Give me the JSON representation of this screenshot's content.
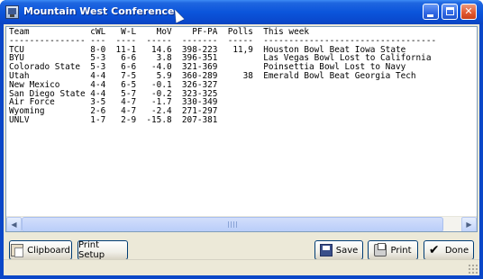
{
  "window": {
    "title": "Mountain West Conference"
  },
  "report": {
    "lines": [
      "Team            cWL   W-L    MoV    PF-PA  Polls  This week",
      "--------------- ---  ----  -----  -------  -----  ----------------------------------",
      "TCU             8-0  11-1   14.6  398-223   11,9  Houston Bowl Beat Iowa State",
      "BYU             5-3   6-6    3.8  396-351         Las Vegas Bowl Lost to California",
      "Colorado State  5-3   6-6   -4.0  321-369         Poinsettia Bowl Lost to Navy",
      "Utah            4-4   7-5    5.9  360-289     38  Emerald Bowl Beat Georgia Tech",
      "New Mexico      4-4   6-5   -0.1  326-327",
      "San Diego State 4-4   5-7   -0.2  323-325",
      "Air Force       3-5   4-7   -1.7  330-349",
      "Wyoming         2-6   4-7   -2.4  271-297",
      "UNLV            1-7   2-9  -15.8  207-381"
    ]
  },
  "buttons": {
    "clipboard": "Clipboard",
    "print_setup": "Print Setup",
    "save": "Save",
    "print": "Print",
    "done": "Done"
  },
  "icons": {
    "scroll_left": "◀",
    "scroll_right": "▶",
    "done_check": "✔"
  }
}
